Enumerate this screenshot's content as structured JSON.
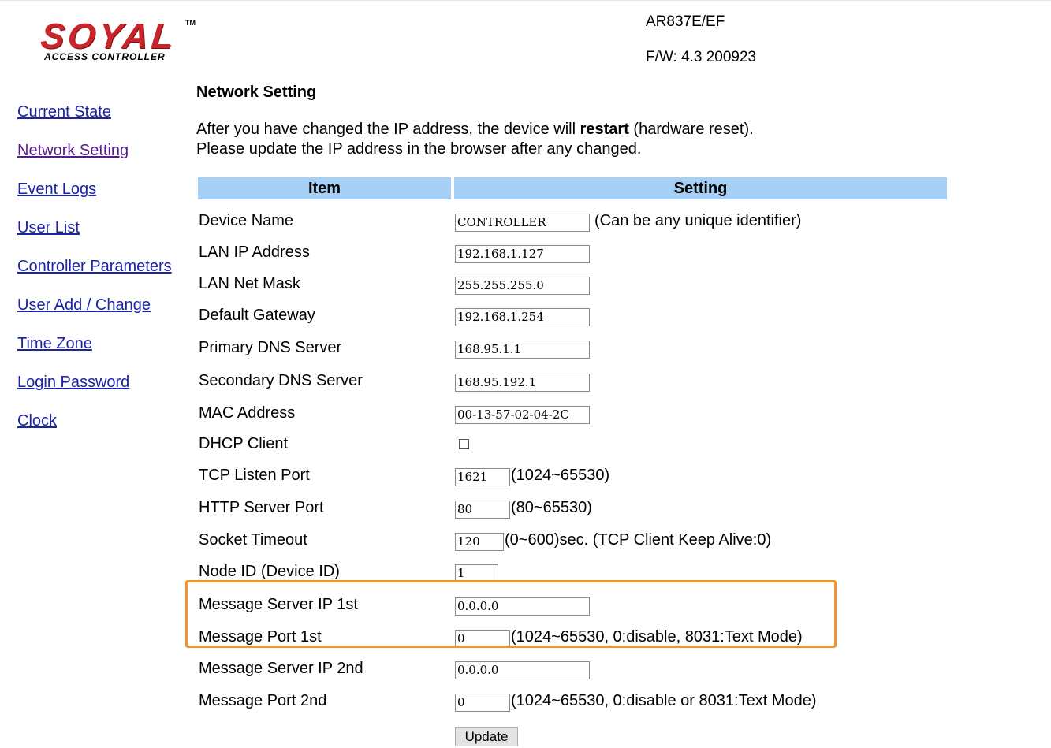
{
  "header": {
    "logo_text": "SOYAL",
    "logo_tm": "TM",
    "logo_subtitle": "ACCESS CONTROLLER",
    "model": "AR837E/EF",
    "firmware": "F/W: 4.3 200923"
  },
  "sidebar": {
    "items": [
      {
        "label": "Current State"
      },
      {
        "label": "Network Setting"
      },
      {
        "label": "Event Logs"
      },
      {
        "label": "User List"
      },
      {
        "label": "Controller Parameters"
      },
      {
        "label": "User Add / Change"
      },
      {
        "label": "Time Zone"
      },
      {
        "label": "Login Password"
      },
      {
        "label": "Clock"
      }
    ]
  },
  "main": {
    "title": "Network Setting",
    "note_line1_before": "After you have changed the IP address, the device will ",
    "note_line1_bold": "restart",
    "note_line1_after": " (hardware reset).",
    "note_line2": "Please update the IP address in the browser after any changed.",
    "table": {
      "headers": {
        "item": "Item",
        "setting": "Setting"
      },
      "rows": [
        {
          "label": "Device Name",
          "value": "CONTROLLER",
          "hint": "(Can be any unique identifier)"
        },
        {
          "label": "LAN IP Address",
          "value": "192.168.1.127"
        },
        {
          "label": "LAN Net Mask",
          "value": "255.255.255.0"
        },
        {
          "label": "Default Gateway",
          "value": "192.168.1.254"
        },
        {
          "label": "Primary DNS Server",
          "value": "168.95.1.1"
        },
        {
          "label": "Secondary DNS Server",
          "value": "168.95.192.1"
        },
        {
          "label": "MAC Address",
          "value": "00-13-57-02-04-2C"
        },
        {
          "label": "DHCP Client",
          "checked": false
        },
        {
          "label": "TCP Listen Port",
          "value": "1621",
          "hint": "(1024~65530)"
        },
        {
          "label": "HTTP Server Port",
          "value": "80",
          "hint": "(80~65530)"
        },
        {
          "label": "Socket Timeout",
          "value": "120",
          "hint": "(0~600)sec. (TCP Client Keep Alive:0)"
        },
        {
          "label": "Node ID (Device ID)",
          "value": "1"
        },
        {
          "label": "Message Server IP 1st",
          "value": "0.0.0.0"
        },
        {
          "label": "Message Port 1st",
          "value": "0",
          "hint": "(1024~65530, 0:disable,  8031:Text Mode)"
        },
        {
          "label": "Message Server IP 2nd",
          "value": "0.0.0.0"
        },
        {
          "label": "Message Port 2nd",
          "value": "0",
          "hint": "(1024~65530, 0:disable or 8031:Text Mode)"
        }
      ]
    },
    "update_label": "Update"
  },
  "colors": {
    "logo_red": "#c8242b",
    "table_header": "#a6cff5",
    "link": "#1a22a8",
    "link_visited": "#551a8b",
    "highlight": "#f0952e"
  }
}
